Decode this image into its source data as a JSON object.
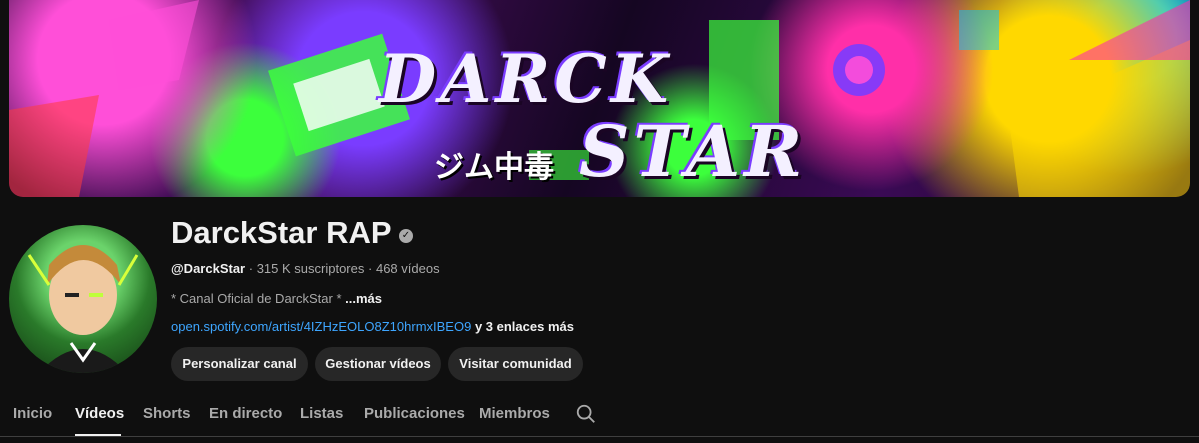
{
  "banner": {
    "title_line1": "DARCK",
    "title_line2": "STAR",
    "kanji": "ジム中毒"
  },
  "channel": {
    "name": "DarckStar RAP",
    "verified_badge": "verified-check-icon",
    "handle": "@DarckStar",
    "separator": "·",
    "subscribers": "315 K suscriptores",
    "videos": "468 vídeos",
    "description": "* Canal Oficial de DarckStar * ",
    "more_label": "...más",
    "link": "open.spotify.com/artist/4IZHzEOLO8Z10hrmxIBEO9",
    "extra_links": "y 3 enlaces más"
  },
  "buttons": {
    "customize": "Personalizar canal",
    "manage": "Gestionar vídeos",
    "community": "Visitar comunidad"
  },
  "tabs": [
    {
      "label": "Inicio",
      "active": false
    },
    {
      "label": "Vídeos",
      "active": true
    },
    {
      "label": "Shorts",
      "active": false
    },
    {
      "label": "En directo",
      "active": false
    },
    {
      "label": "Listas",
      "active": false
    },
    {
      "label": "Publicaciones",
      "active": false
    },
    {
      "label": "Miembros",
      "active": false
    }
  ],
  "icons": {
    "tab_search": "search-icon"
  },
  "colors": {
    "background": "#0f0f0f",
    "link": "#3ea6ff",
    "button_bg": "#272727",
    "muted_text": "#aaaaaa"
  }
}
